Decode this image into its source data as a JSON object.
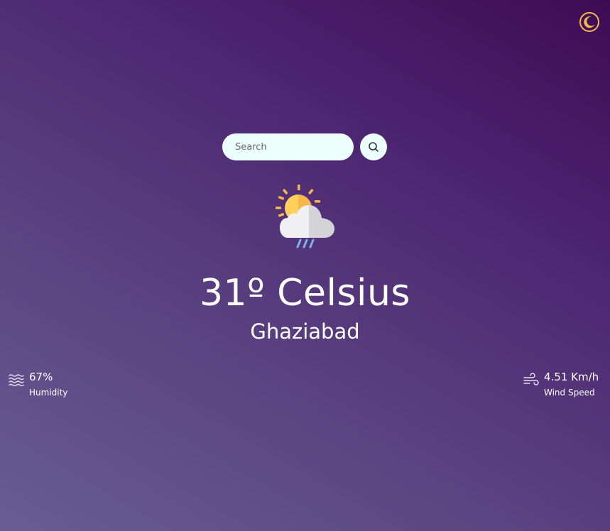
{
  "header": {
    "theme_toggle_icon": "moon-icon"
  },
  "search": {
    "placeholder": "Search",
    "value": "",
    "button_icon": "search-icon"
  },
  "weather": {
    "condition_icon": "sun-cloud-rain-icon",
    "temperature": "31º Celsius",
    "city": "Ghaziabad"
  },
  "stats": {
    "humidity": {
      "icon": "humidity-waves-icon",
      "value": "67%",
      "label": "Humidity"
    },
    "wind": {
      "icon": "wind-icon",
      "value": "4.51 Km/h",
      "label": "Wind Speed"
    }
  },
  "colors": {
    "background_start": "#675d94",
    "background_end": "#3d0c55",
    "input_bg": "#ebfffc",
    "moon": "#f7b84b",
    "sun": "#ffd05b",
    "rain": "#7fb1f0"
  }
}
